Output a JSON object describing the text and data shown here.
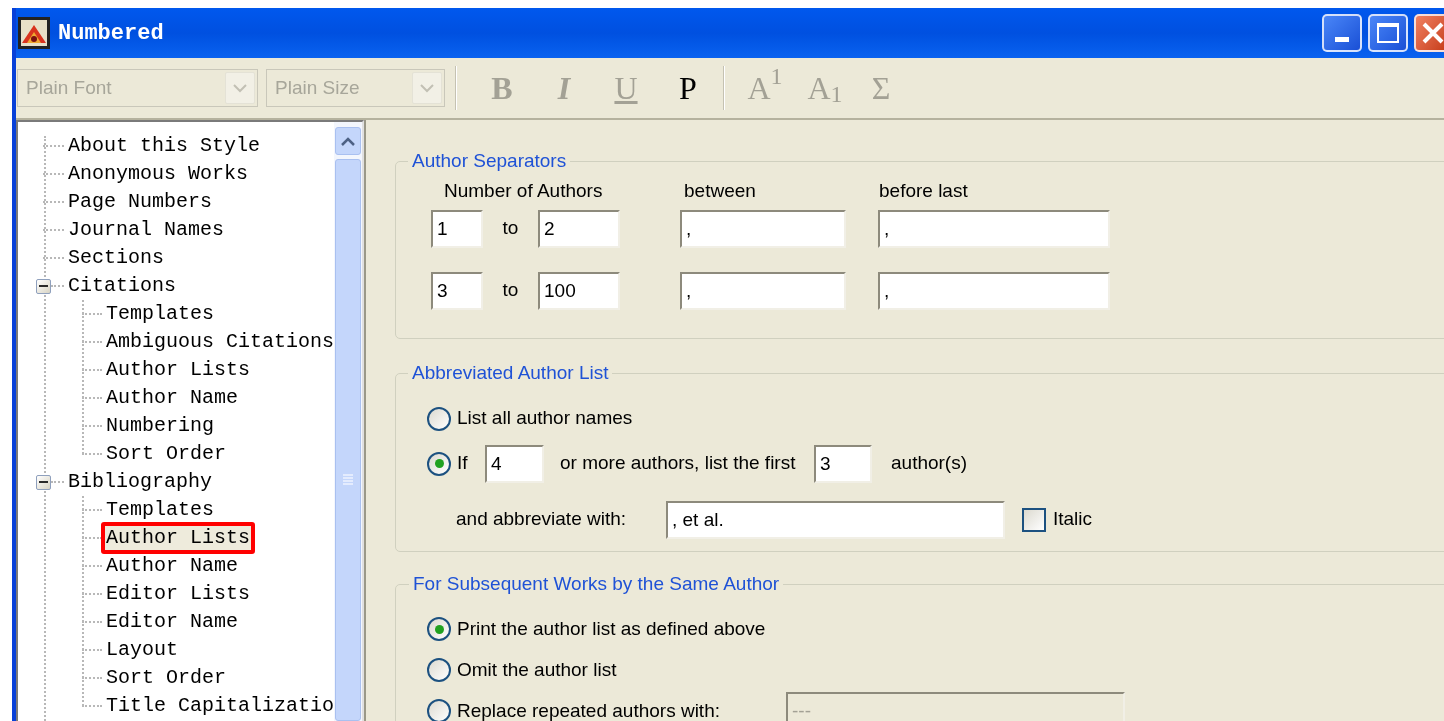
{
  "window": {
    "title": "Numbered"
  },
  "toolbar": {
    "font_combo": {
      "value": "Plain Font",
      "disabled": true
    },
    "size_combo": {
      "value": "Plain Size",
      "disabled": true
    },
    "buttons": [
      {
        "kind": "bold",
        "label": "B",
        "disabled": true
      },
      {
        "kind": "italic",
        "label": "I",
        "disabled": true
      },
      {
        "kind": "underline",
        "label": "U",
        "disabled": true
      },
      {
        "kind": "plain",
        "label": "P",
        "disabled": false
      },
      {
        "kind": "superscript",
        "label": "A$^{1}$",
        "disabled": true
      },
      {
        "kind": "subscript",
        "label": "A$_{1}$",
        "disabled": true
      },
      {
        "kind": "symbol",
        "label": "Σ",
        "disabled": true
      }
    ]
  },
  "tree": {
    "items": [
      {
        "label": "About this Style",
        "selected": false,
        "annotated": false
      },
      {
        "label": "Anonymous Works",
        "selected": false,
        "annotated": false
      },
      {
        "label": "Page Numbers",
        "selected": false,
        "annotated": false
      },
      {
        "label": "Journal Names",
        "selected": false,
        "annotated": false
      },
      {
        "label": "Sections",
        "selected": false,
        "annotated": false
      },
      {
        "label": "Citations",
        "selected": false,
        "annotated": false,
        "expanded": true,
        "children": [
          {
            "label": "Templates",
            "selected": false,
            "annotated": false
          },
          {
            "label": "Ambiguous Citations",
            "selected": false,
            "annotated": false
          },
          {
            "label": "Author Lists",
            "selected": false,
            "annotated": false
          },
          {
            "label": "Author Name",
            "selected": false,
            "annotated": false
          },
          {
            "label": "Numbering",
            "selected": false,
            "annotated": false
          },
          {
            "label": "Sort Order",
            "selected": false,
            "annotated": false
          }
        ]
      },
      {
        "label": "Bibliography",
        "selected": false,
        "annotated": false,
        "expanded": true,
        "children": [
          {
            "label": "Templates",
            "selected": false,
            "annotated": false
          },
          {
            "label": "Author Lists",
            "selected": true,
            "annotated": true
          },
          {
            "label": "Author Name",
            "selected": false,
            "annotated": false
          },
          {
            "label": "Editor Lists",
            "selected": false,
            "annotated": false
          },
          {
            "label": "Editor Name",
            "selected": false,
            "annotated": false
          },
          {
            "label": "Layout",
            "selected": false,
            "annotated": false
          },
          {
            "label": "Sort Order",
            "selected": false,
            "annotated": false
          },
          {
            "label": "Title Capitalizatio",
            "selected": false,
            "annotated": false
          }
        ]
      }
    ]
  },
  "author_separators": {
    "title": "Author Separators",
    "headers": [
      "Number of Authors",
      "between",
      "before last"
    ],
    "rows": [
      {
        "from": "1",
        "to_label": "to",
        "to": "2",
        "between": ",",
        "before_last": ","
      },
      {
        "from": "3",
        "to_label": "to",
        "to": "100",
        "between": ",",
        "before_last": ","
      }
    ]
  },
  "abbreviated_author_list": {
    "title": "Abbreviated Author List",
    "options": [
      {
        "kind": "plain",
        "label": "List all author names",
        "selected": false
      },
      {
        "kind": "threshold",
        "label": "If",
        "selected": true,
        "min_authors": "4",
        "middle": "or more authors, list the first",
        "first_count": "3",
        "suffix": "author(s)"
      }
    ],
    "abbreviate": {
      "label": "and abbreviate with:",
      "value": ", et al.",
      "italic_label": "Italic",
      "italic_checked": false
    }
  },
  "subsequent_works": {
    "title": "For Subsequent Works by the Same Author",
    "options": [
      {
        "kind": "plain",
        "label": "Print the author list as defined above",
        "selected": true
      },
      {
        "kind": "plain",
        "label": "Omit the author list",
        "selected": false
      },
      {
        "kind": "replace",
        "label": "Replace repeated authors with:",
        "selected": false,
        "value": "---",
        "disabled": true
      }
    ]
  }
}
